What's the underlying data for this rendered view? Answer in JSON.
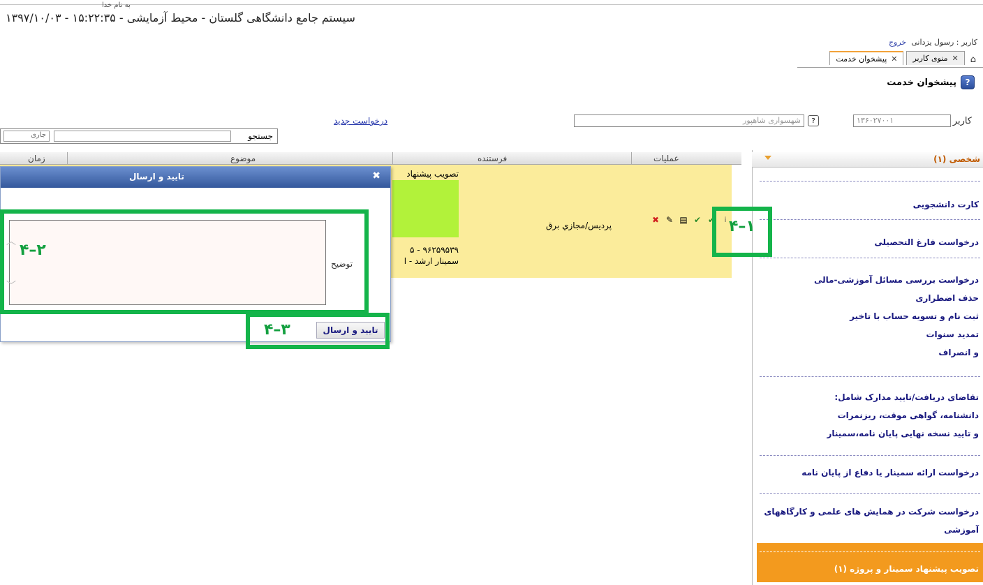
{
  "header": {
    "basmala": "به نام خدا",
    "system_title": "سیستم جامع دانشگاهی گلستان - محیط آزمایشی - ۱۵:۲۲:۳۵ - ۱۳۹۷/۱۰/۰۳",
    "user_prefix": "کاربر : رسول یزدانی",
    "logout": "خروج"
  },
  "tabs": [
    {
      "label": "منوی کاربر",
      "active": false
    },
    {
      "label": "پیشخوان خدمت",
      "active": true
    }
  ],
  "page_title": "پیشخوان خدمت",
  "filter": {
    "user_label": "کاربر",
    "user_code": "۱۳۶۰۲۷۰۰۱",
    "user_name": "شهسواری شاهپور",
    "help_button": "?",
    "new_request": "درخواست جدید",
    "search_label": "جستجو",
    "search_value": "",
    "status_select": "جاری"
  },
  "table": {
    "headers": [
      "عملیات",
      "فرستنده",
      "موضوع",
      "زمان"
    ],
    "row": {
      "subject_top": "تصویب پیشنهاد",
      "subject_line1": "۹۶۲۵۹۵۳۹ - ۵",
      "subject_line2": "سمینار ارشد - ا",
      "sender": "پردیس/مجازي برق"
    }
  },
  "dialog": {
    "title": "تایید و ارسال",
    "comment_label": "توضیح",
    "comment_value": "",
    "submit_label": "تایید و ارسال"
  },
  "sidebar": {
    "header": "شخصی (۱)",
    "items": [
      "کارت دانشجویی",
      "درخواست فارغ التحصیلی",
      "درخواست بررسی مسائل آموزشی-مالی",
      "حذف اضطراری",
      "ثبت نام و تسویه حساب با تاخیر",
      "تمدید سنوات",
      "و انصراف",
      "تقاضای دریافت/تایید مدارک شامل:",
      "دانشنامه، گواهی موقت، ریزنمرات",
      "و تایید نسخه نهایی پایان نامه،سمینار",
      "درخواست ارائه سمینار یا دفاع از پایان نامه",
      "درخواست شرکت در همایش های علمی و کارگاههای",
      "آموزشی"
    ],
    "active_item": "تصویب پیشنهاد سمینار و پروژه (۱)"
  },
  "annotations": {
    "a1": "۴–۱",
    "a2": "۴–۲",
    "a3": "۴–۳"
  },
  "colors": {
    "row_bg": "#fbec9b",
    "highlight_green": "#b2f23a",
    "active_item_bg": "#f39a1e",
    "annotation": "#14b44a",
    "dialog_title": "#34589c"
  }
}
